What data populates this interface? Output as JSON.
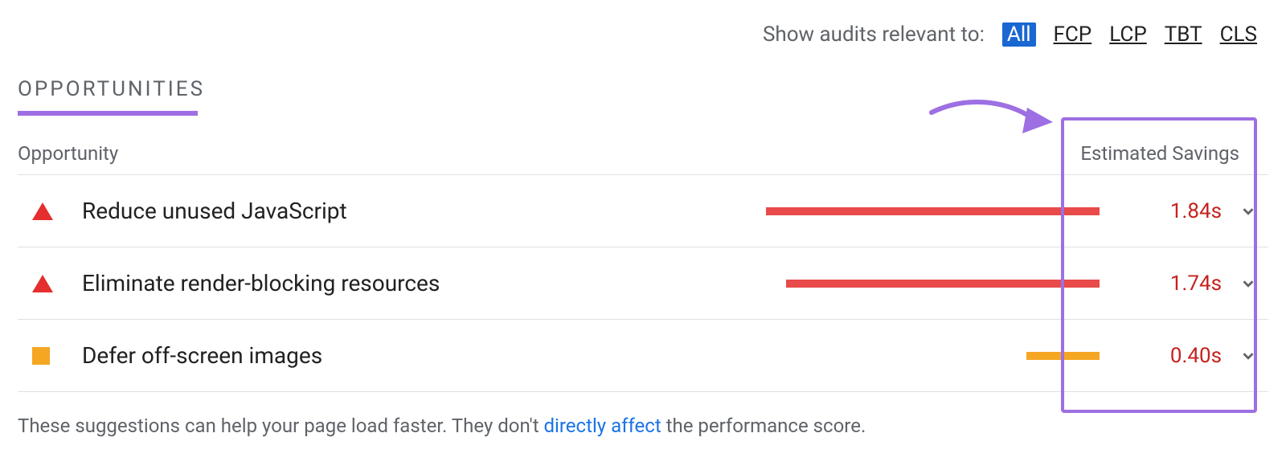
{
  "filter": {
    "label": "Show audits relevant to:",
    "items": [
      "All",
      "FCP",
      "LCP",
      "TBT",
      "CLS"
    ],
    "active": "All"
  },
  "section_title": "OPPORTUNITIES",
  "columns": {
    "opportunity": "Opportunity",
    "savings": "Estimated Savings"
  },
  "rows": [
    {
      "severity": "red-triangle",
      "label": "Reduce unused JavaScript",
      "savings": "1.84s",
      "bar_pct": 100,
      "bar_color": "red"
    },
    {
      "severity": "red-triangle",
      "label": "Eliminate render-blocking resources",
      "savings": "1.74s",
      "bar_pct": 94,
      "bar_color": "red"
    },
    {
      "severity": "orange-square",
      "label": "Defer off-screen images",
      "savings": "0.40s",
      "bar_pct": 22,
      "bar_color": "orange"
    }
  ],
  "footer": {
    "pre": "These suggestions can help your page load faster. They don't ",
    "link": "directly affect",
    "post": " the performance score."
  }
}
